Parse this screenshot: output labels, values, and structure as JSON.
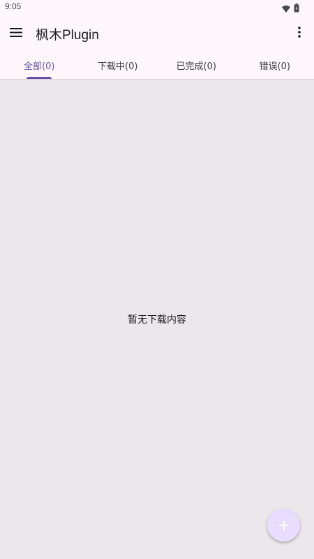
{
  "status_bar": {
    "time": "9:05",
    "icons": [
      "wifi-icon",
      "battery-icon"
    ]
  },
  "app_bar": {
    "title": "枫木Plugin",
    "menu_icon": "hamburger-menu-icon",
    "more_icon": "more-vert-icon"
  },
  "tabs": [
    {
      "label": "全部(0)",
      "active": true
    },
    {
      "label": "下载中(0)",
      "active": false
    },
    {
      "label": "已完成(0)",
      "active": false
    },
    {
      "label": "错误(0)",
      "active": false
    }
  ],
  "content": {
    "empty_message": "暂无下载内容"
  },
  "fab": {
    "icon": "plus-icon"
  },
  "colors": {
    "accent": "#6750a4",
    "surface": "#fdf7fb",
    "background": "#ece7ea",
    "fab": "#e9ddff"
  }
}
